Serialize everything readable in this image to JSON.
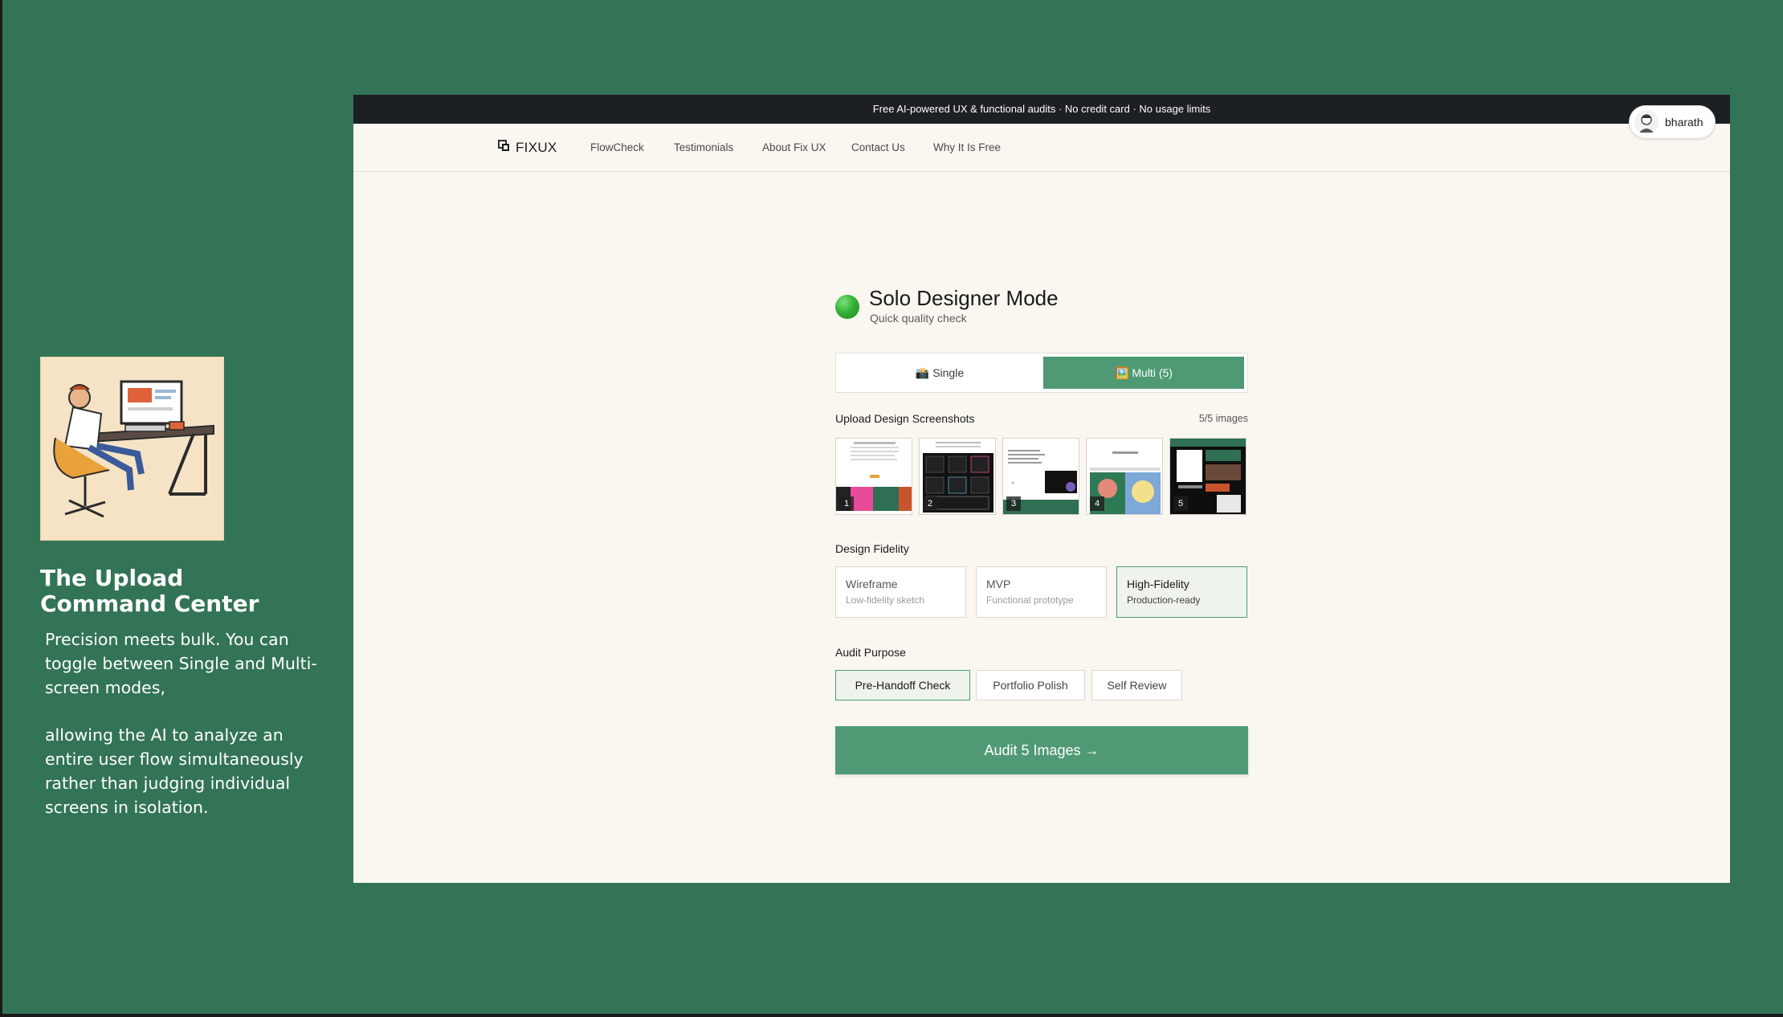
{
  "slide": {
    "title": "The Upload Command Center",
    "paragraph1": "Precision meets bulk. You can toggle between Single and Multi-screen modes,",
    "paragraph2": "allowing the AI to analyze an entire user flow simultaneously rather than judging individual screens in isolation."
  },
  "banner": "Free AI-powered UX & functional audits · No credit card · No usage limits",
  "user": {
    "name": "bharath"
  },
  "nav": {
    "logo": "FIXUX",
    "links": [
      "FlowCheck",
      "Testimonials",
      "About Fix UX",
      "Contact Us",
      "Why It Is Free"
    ]
  },
  "mode": {
    "title": "Solo Designer Mode",
    "subtitle": "Quick quality check",
    "status_color": "#36b236"
  },
  "toggle": {
    "single_label": "📸 Single",
    "multi_label": "🖼️ Multi (5)",
    "selected": "multi"
  },
  "upload": {
    "label": "Upload Design Screenshots",
    "count": "5/5 images",
    "thumbnails": [
      "1",
      "2",
      "3",
      "4",
      "5"
    ]
  },
  "fidelity": {
    "label": "Design Fidelity",
    "options": [
      {
        "name": "Wireframe",
        "desc": "Low-fidelity sketch"
      },
      {
        "name": "MVP",
        "desc": "Functional prototype"
      },
      {
        "name": "High-Fidelity",
        "desc": "Production-ready"
      }
    ],
    "selected": "High-Fidelity"
  },
  "purpose": {
    "label": "Audit Purpose",
    "options": [
      "Pre-Handoff Check",
      "Portfolio Polish",
      "Self Review"
    ],
    "selected": "Pre-Handoff Check"
  },
  "cta": "Audit 5 Images →",
  "colors": {
    "background": "#337456",
    "accent": "#4f9a74",
    "page": "#faf7f1",
    "banner": "#1c1f24"
  }
}
